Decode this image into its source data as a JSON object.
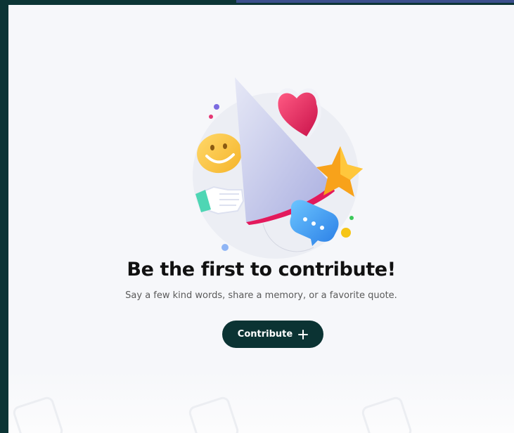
{
  "empty_state": {
    "title": "Be the first to contribute!",
    "subtitle": "Say a few kind words, share a memory, or a favorite quote.",
    "contribute_label": "Contribute"
  },
  "illustration": {
    "icons": [
      "party-hat-icon",
      "heart-icon",
      "smiley-icon",
      "star-icon",
      "thumbs-up-icon",
      "chat-bubble-icon"
    ]
  },
  "colors": {
    "button_bg": "#0b3333",
    "panel_bg": "#f6f7fa",
    "frame_bg": "#0c3535"
  }
}
